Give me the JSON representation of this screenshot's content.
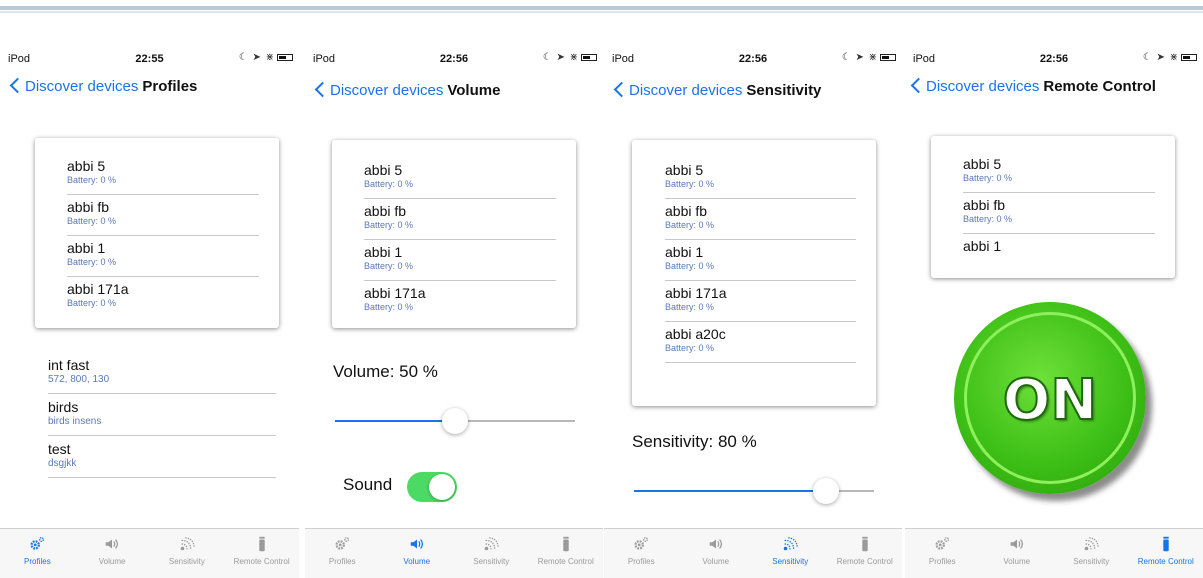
{
  "colors": {
    "accent": "#1a73e8",
    "subtext": "#5b79b8",
    "toggle_on": "#4cd964",
    "on_button": "#3dbf16"
  },
  "screens": [
    {
      "status": {
        "carrier": "iPod",
        "time": "22:55"
      },
      "nav": {
        "back": "Discover devices",
        "title": "Profiles"
      },
      "devices": [
        {
          "name": "abbi 5",
          "battery": "Battery: 0 %"
        },
        {
          "name": "abbi fb",
          "battery": "Battery: 0 %"
        },
        {
          "name": "abbi 1",
          "battery": "Battery: 0 %"
        },
        {
          "name": "abbi 171a",
          "battery": "Battery: 0 %"
        }
      ],
      "profiles": [
        {
          "name": "int fast",
          "detail": "572, 800, 130"
        },
        {
          "name": "birds",
          "detail": "birds insens"
        },
        {
          "name": "test",
          "detail": "dsgjkk"
        }
      ],
      "active_tab": "Profiles"
    },
    {
      "status": {
        "carrier": "iPod",
        "time": "22:56"
      },
      "nav": {
        "back": "Discover devices",
        "title": "Volume"
      },
      "devices": [
        {
          "name": "abbi 5",
          "battery": "Battery: 0 %"
        },
        {
          "name": "abbi fb",
          "battery": "Battery: 0 %"
        },
        {
          "name": "abbi 1",
          "battery": "Battery: 0 %"
        },
        {
          "name": "abbi 171a",
          "battery": "Battery: 0 %"
        }
      ],
      "volume_label": "Volume: 50 %",
      "volume_value": 0.5,
      "sound_label": "Sound",
      "sound_on": true,
      "active_tab": "Volume"
    },
    {
      "status": {
        "carrier": "iPod",
        "time": "22:56"
      },
      "nav": {
        "back": "Discover devices",
        "title": "Sensitivity"
      },
      "devices": [
        {
          "name": "abbi 5",
          "battery": "Battery: 0 %"
        },
        {
          "name": "abbi fb",
          "battery": "Battery: 0 %"
        },
        {
          "name": "abbi 1",
          "battery": "Battery: 0 %"
        },
        {
          "name": "abbi 171a",
          "battery": "Battery: 0 %"
        },
        {
          "name": "abbi a20c",
          "battery": "Battery: 0 %"
        }
      ],
      "sensitivity_label": "Sensitivity: 80 %",
      "sensitivity_value": 0.8,
      "active_tab": "Sensitivity"
    },
    {
      "status": {
        "carrier": "iPod",
        "time": "22:56"
      },
      "nav": {
        "back": "Discover devices",
        "title": "Remote Control"
      },
      "devices": [
        {
          "name": "abbi 5",
          "battery": "Battery: 0 %"
        },
        {
          "name": "abbi fb",
          "battery": "Battery: 0 %"
        },
        {
          "name": "abbi 1",
          "battery": ""
        }
      ],
      "on_label": "ON",
      "active_tab": "Remote Control"
    }
  ],
  "tabs": [
    {
      "label": "Profiles",
      "icon": "gears-icon"
    },
    {
      "label": "Volume",
      "icon": "speaker-icon"
    },
    {
      "label": "Sensitivity",
      "icon": "signal-icon"
    },
    {
      "label": "Remote Control",
      "icon": "remote-icon"
    }
  ]
}
